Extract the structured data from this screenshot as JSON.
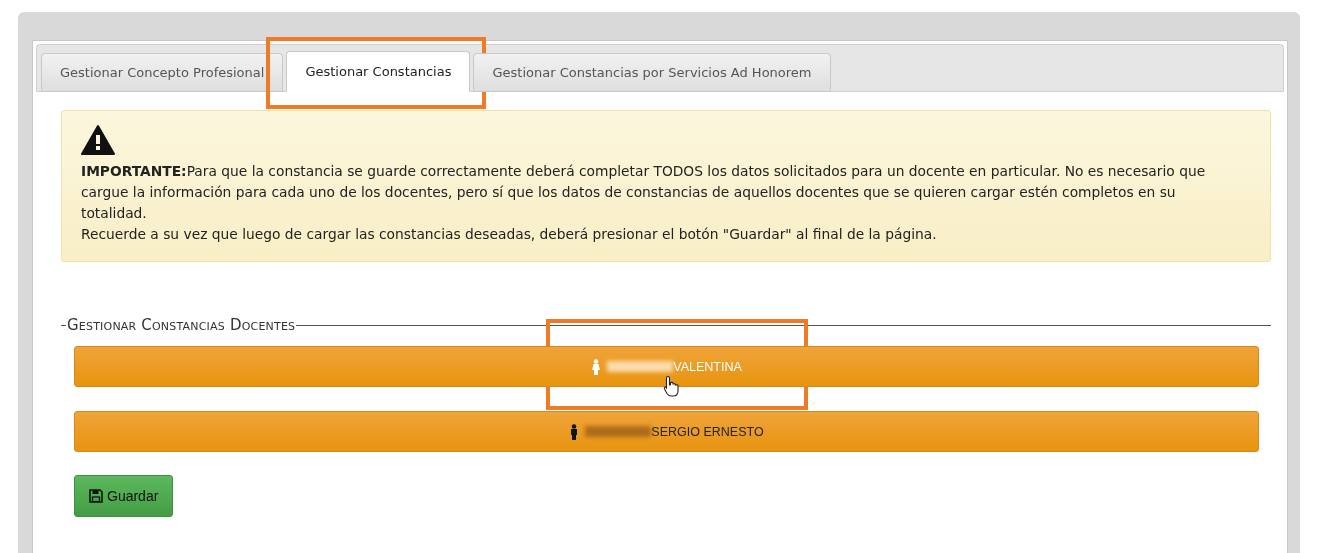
{
  "tabs": [
    {
      "label": "Gestionar Concepto Profesional",
      "selected": false,
      "highlighted": false
    },
    {
      "label": "Gestionar Constancias",
      "selected": true,
      "highlighted": true
    },
    {
      "label": "Gestionar Constancias por Servicios Ad Honorem",
      "selected": false,
      "highlighted": false
    }
  ],
  "alert": {
    "lead": "**IMPORTANTE:**Para que la constancia se guarde correctamente deberá completar TODOS los datos solicitados para un docente en particular. No es necesario que cargue la información para cada uno de los docentes, pero sí que los datos de constancias de aquellos docentes que se quieren cargar estén completos en su totalidad.",
    "note": "Recuerde a su vez que luego de cargar las constancias deseadas, deberá presionar el botón \"Guardar\" al final de la página."
  },
  "section": {
    "legend": "Gestionar Constancias Docentes"
  },
  "teachers": [
    {
      "name": "VALENTINA",
      "kind": "female",
      "hovered": true,
      "highlighted": true
    },
    {
      "name": "SERGIO ERNESTO",
      "kind": "male",
      "hovered": false,
      "highlighted": false
    }
  ],
  "save_button": {
    "label": "Guardar"
  }
}
